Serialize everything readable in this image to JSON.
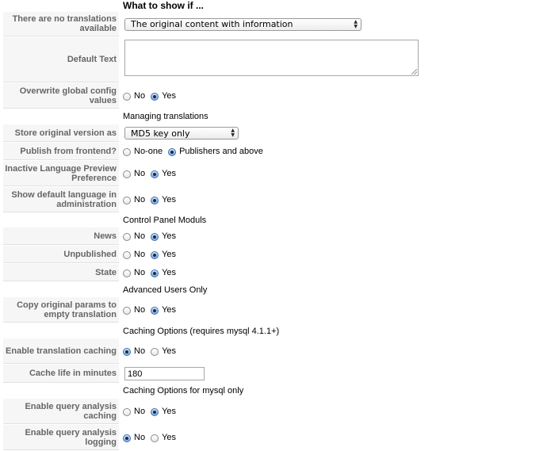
{
  "header": "What to show if ...",
  "no_translations": {
    "label": "There are no translations available",
    "selected": "The original content with information"
  },
  "default_text": {
    "label": "Default Text",
    "value": ""
  },
  "overwrite_global": {
    "label": "Overwrite global config values",
    "selected": "Yes"
  },
  "section_managing": "Managing translations",
  "store_original": {
    "label": "Store original version as",
    "selected": "MD5 key only"
  },
  "publish_frontend": {
    "label": "Publish from frontend?",
    "options": [
      "No-one",
      "Publishers and above"
    ],
    "selected": "Publishers and above"
  },
  "inactive_language": {
    "label": "Inactive Language Preview Preference",
    "selected": "Yes"
  },
  "show_default_lang": {
    "label": "Show default language in administration",
    "selected": "Yes"
  },
  "section_cpanel": "Control Panel Moduls",
  "news": {
    "label": "News",
    "selected": "Yes"
  },
  "unpublished": {
    "label": "Unpublished",
    "selected": "Yes"
  },
  "state": {
    "label": "State",
    "selected": "Yes"
  },
  "section_advanced": "Advanced Users Only",
  "copy_params": {
    "label": "Copy original params to empty translation",
    "selected": "Yes"
  },
  "section_caching": "Caching Options (requires mysql 4.1.1+)",
  "enable_caching": {
    "label": "Enable translation caching",
    "selected": "No"
  },
  "cache_life": {
    "label": "Cache life in minutes",
    "value": "180"
  },
  "section_caching_mysql": "Caching Options for mysql only",
  "query_analysis_caching": {
    "label": "Enable query analysis caching",
    "selected": "Yes"
  },
  "query_analysis_logging": {
    "label": "Enable query analysis logging",
    "selected": "No"
  },
  "opts": {
    "no": "No",
    "yes": "Yes"
  }
}
